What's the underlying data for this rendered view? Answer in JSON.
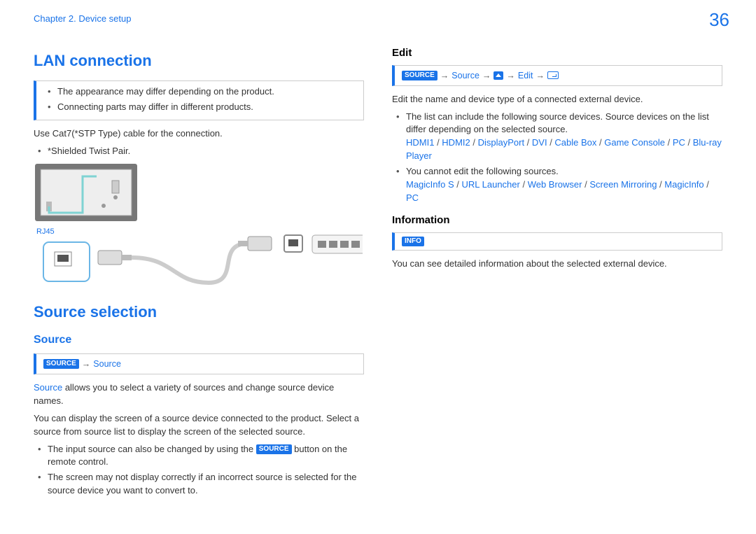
{
  "breadcrumb": "Chapter 2. Device setup",
  "page_number": "36",
  "left": {
    "h1_lan": "LAN connection",
    "notes": [
      "The appearance may differ depending on the product.",
      "Connecting parts may differ in different products."
    ],
    "cable_line": "Use Cat7(*STP Type) cable for the connection.",
    "stp_note": "*Shielded Twist Pair.",
    "rj45_label": "RJ45",
    "h1_source_sel": "Source selection",
    "h2_source": "Source",
    "src_badge": "SOURCE",
    "src_path_text": "Source",
    "source_para_lead": "Source",
    "source_para_rest": " allows you to select a variety of sources and change source device names.",
    "source_para2": "You can display the screen of a source device connected to the product. Select a source from source list to display the screen of the selected source.",
    "source_bullets_pre": "The input source can also be changed by using the ",
    "source_bullets_post": " button on the remote control.",
    "source_bullets_2": "The screen may not display correctly if an incorrect source is selected for the source device you want to convert to."
  },
  "right": {
    "h2_edit": "Edit",
    "edit_path": {
      "src_badge": "SOURCE",
      "source": "Source",
      "edit": "Edit"
    },
    "edit_intro": "Edit the name and device type of a connected external device.",
    "edit_bullet1": "The list can include the following source devices. Source devices on the list differ depending on the selected source.",
    "edit_sources": [
      "HDMI1",
      "HDMI2",
      "DisplayPort",
      "DVI",
      "Cable Box",
      "Game Console",
      "PC",
      "Blu-ray Player"
    ],
    "edit_bullet2": "You cannot edit the following sources.",
    "edit_locked": [
      "MagicInfo S",
      "URL Launcher",
      "Web Browser",
      "Screen Mirroring",
      "MagicInfo",
      "PC"
    ],
    "h2_info": "Information",
    "info_badge": "INFO",
    "info_text": "You can see detailed information about the selected external device."
  },
  "sep": " / ",
  "arrow": "→"
}
